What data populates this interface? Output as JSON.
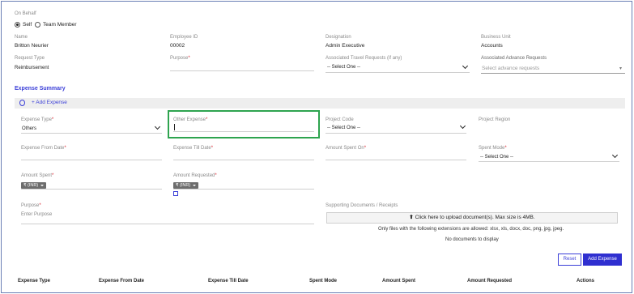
{
  "on_behalf": {
    "label": "On Behalf",
    "options": [
      {
        "label": "Self",
        "selected": true
      },
      {
        "label": "Team Member",
        "selected": false
      }
    ]
  },
  "employee": {
    "name_label": "Name",
    "name_value": "Britton Neurier",
    "id_label": "Employee ID",
    "id_value": "00002",
    "designation_label": "Designation",
    "designation_value": "Admin Executive",
    "business_unit_label": "Business Unit",
    "business_unit_value": "Accounts"
  },
  "request": {
    "type_label": "Request Type",
    "type_value": "Reimbursement",
    "purpose_label": "Purpose",
    "purpose_value": "",
    "travel_label": "Associated Travel Requests (if any)",
    "travel_value": "-- Select One --",
    "advance_label": "Associated Advance Requests",
    "advance_placeholder": "Select advance requests"
  },
  "expense_summary": {
    "title": "Expense Summary",
    "add_expense_link": "Add Expense"
  },
  "form": {
    "expense_type_label": "Expense Type",
    "expense_type_value": "Others",
    "other_expense_label": "Other Expense",
    "other_expense_value": "",
    "project_code_label": "Project Code",
    "project_code_value": "-- Select One --",
    "project_region_label": "Project Region",
    "from_date_label": "Expense From Date",
    "till_date_label": "Expense Till Date",
    "amount_spent_on_label": "Amount Spent On",
    "spent_mode_label": "Spent Mode",
    "spent_mode_value": "-- Select One --",
    "amount_spent_label": "Amount Spent",
    "amount_spent_currency": "₹ (INR)",
    "amount_requested_label": "Amount Requested",
    "amount_requested_currency": "₹ (INR)",
    "purpose_label": "Purpose",
    "purpose_placeholder": "Enter Purpose",
    "supporting_docs_label": "Supporting Documents / Receipts",
    "upload_label": "Click here to upload document(s). Max size is 4MB.",
    "extensions_note": "Only files with the following extensions are allowed: xlsx, xls, docx, doc, png, jpg, jpeg.",
    "no_docs": "No documents to display",
    "reset_label": "Reset",
    "add_expense_label": "Add Expense",
    "required_mark": "*"
  },
  "table": {
    "headers": [
      "Expense Type",
      "Expense From Date",
      "Expense Till Date",
      "Spent Mode",
      "Amount Spent",
      "Amount Requested",
      "Actions"
    ]
  },
  "colors": {
    "accent": "#3b3fd8",
    "highlight": "#2ea44f",
    "required": "#d9232e"
  }
}
